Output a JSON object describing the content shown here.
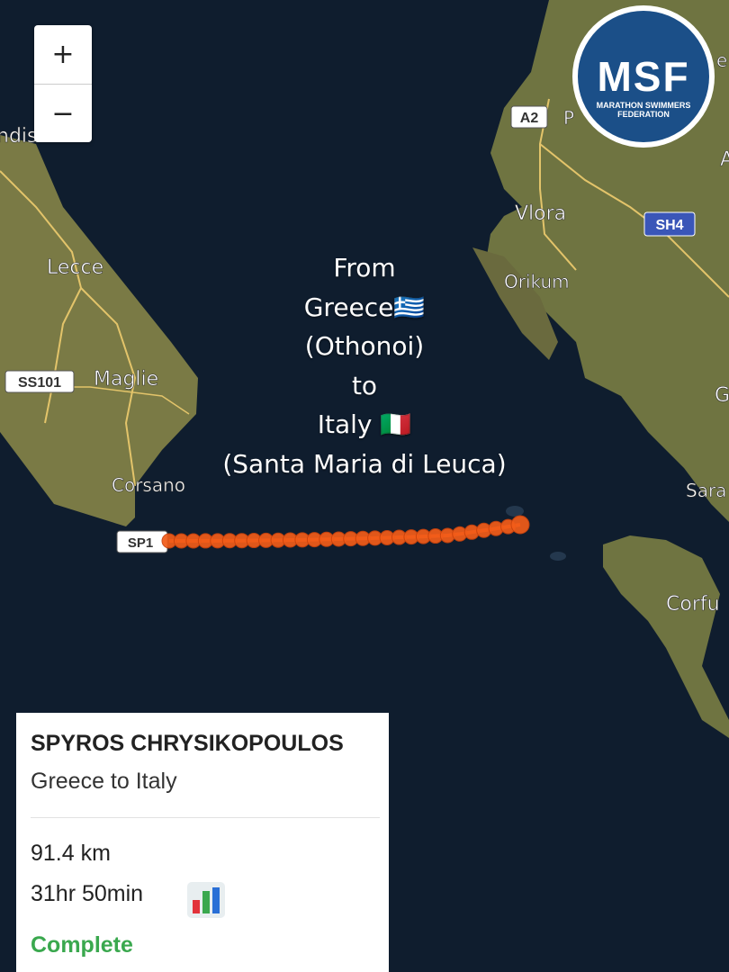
{
  "map": {
    "places": {
      "brindisi": "ndis",
      "lecce": "Lecce",
      "maglie": "Maglie",
      "corsano": "Corsano",
      "vlora": "Vlora",
      "orikum": "Orikum",
      "corfu": "Corfu",
      "sara": "Sara",
      "g": "G",
      "e": "e",
      "p": "P",
      "a": "A"
    },
    "road_shields": {
      "ss101": "SS101",
      "a2": "A2",
      "sh4": "SH4",
      "sp": "SP1"
    },
    "colors": {
      "sea": "#0f1d2e",
      "land": "#7a7a45",
      "track": "#f25c19",
      "road": "#e3c46a"
    }
  },
  "zoom": {
    "in_label": "+",
    "out_label": "−"
  },
  "logo": {
    "text": "MSF",
    "subtitle_line1": "MARATHON SWIMMERS",
    "subtitle_line2": "FEDERATION"
  },
  "overlay": {
    "line1": "From",
    "line2": "Greece🇬🇷",
    "line3": "(Othonoi)",
    "line4": "to",
    "line5": "Italy 🇮🇹",
    "line6": "(Santa Maria di Leuca)"
  },
  "card": {
    "name": "SPYROS CHRYSIKOPOULOS",
    "route": "Greece to Italy",
    "distance": "91.4 km",
    "duration": "31hr 50min",
    "stats_icon": "bar-chart-icon",
    "status": "Complete",
    "status_color": "#3aa84e"
  }
}
